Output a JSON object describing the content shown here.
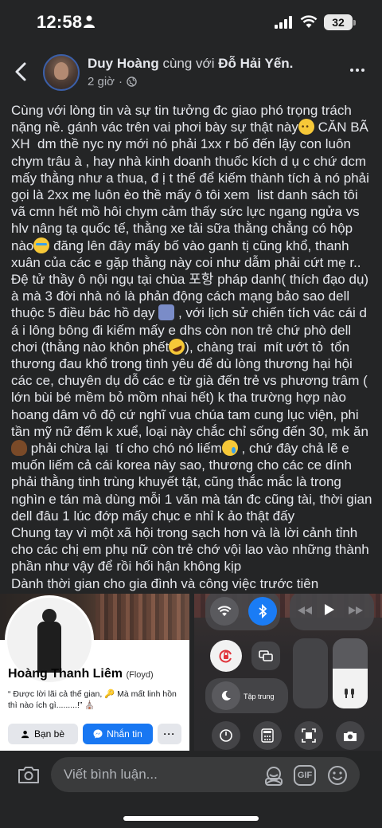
{
  "status_bar": {
    "time": "12:58",
    "battery": "32"
  },
  "header": {
    "author": "Duy Hoàng",
    "with_text": "cùng với",
    "tagged": "Đỗ Hải Yến.",
    "time_ago": "2 giờ",
    "separator": "·"
  },
  "post": {
    "paragraphs": [
      {
        "parts": [
          {
            "t": "Cùng với lòng tin và sự tin tưởng đc giao phó trọng trách nặng nề. gánh vác trên vai phơi bày sự thật này"
          },
          {
            "e": "frown"
          },
          {
            "t": " CĂN BÃ XH  dm thề nyc ny mới nó phải 1xx r bố đến lậy con luôn chym trâu à , hay nhà kinh doanh thuốc kích d ụ c chứ dcm mấy thằng như a thua, đ ị t thế để kiếm thành tích à nó phải gọi là 2xx mẹ luôn èo thề mấy ô tôi xem  list danh sách tôi vã cmn hết mồ hôi chym cảm thấy sức lực ngang ngửa vs hlv nâng tạ quốc tế, thằng xe tải sữa thằng chẳng có hộp nào"
          },
          {
            "e": "cry"
          },
          {
            "t": " đăng lên đây mấy bố vào ganh tị cũng khổ, thanh xuân của các e gặp thằng này coi như dẫm phải cứt mẹ r.."
          }
        ]
      },
      {
        "parts": [
          {
            "t": "Đệ tử thầy ô nội ngụ tại chùa 포항 pháp danh( thích đạo dụ) à mà 3 đời nhà nó là phản động cách mạng bảo sao dell thuộc 5 điều bác hồ dạy "
          },
          {
            "e": "shrug"
          },
          {
            "t": " , với lịch sử chiến tích vác cái d á i lông bông đi kiếm mấy e dhs còn non trẻ chứ phò dell chơi (thằng nào khôn phết"
          },
          {
            "e": "rofl"
          },
          {
            "t": "), chàng trai  mít ướt tỏ  tổn thương đau khổ trong tình yêu để dù lòng thương hại hội các ce, chuyên dụ dỗ các e từ già đến trẻ vs phương trâm ( lớn bùi bé mềm bỏ mồm nhai hết) k tha trường hợp nào hoang dâm vô độ cứ nghĩ vua chúa tam cung lục viện, phi tần mỹ nữ đếm k xuể, loại này chắc chỉ sống đến 30, mk ăn "
          },
          {
            "e": "poop"
          },
          {
            "t": " phải chừa lại  tí cho chó nó liếm"
          },
          {
            "e": "sad"
          },
          {
            "t": " , chứ đây chả lẽ e muốn liếm cả cái korea này sao, thương cho các ce dính phải thằng tinh trùng khuyết tật, cũng thắc mắc là trong nghìn e tán mà dùng mỗi 1 văn mà tán đc cũng tài, thời gian dell đâu 1 lúc đớp mấy chục e nhỉ k ảo thật đấy"
          }
        ]
      },
      {
        "parts": [
          {
            "t": "Chung tay vì một xã hội trong sạch hơn và là lời cảnh tỉnh cho các chị em phụ nữ còn trẻ chớ vội lao vào những thành phần như vậy để rồi hối hận không kịp"
          }
        ]
      },
      {
        "parts": [
          {
            "t": "Dành thời gian cho gia đình và công việc trước tiên"
          }
        ]
      }
    ]
  },
  "images": {
    "profile": {
      "name": "Hoàng Thanh Liêm",
      "nickname": "(Floyd)",
      "bio": "“ Được lời lãi cả thế gian,   🔑       Mà mất linh hồn thì nào ích gì.........!” ⛪",
      "friends_button": "Bạn bè",
      "message_button": "Nhắn tin",
      "more_button": "···"
    },
    "control_center": {
      "focus_label": "Tập trung"
    }
  },
  "comment_bar": {
    "placeholder": "Viết bình luận...",
    "gif_label": "GIF"
  },
  "colors": {
    "background": "#242526",
    "accent": "#1877f2",
    "input": "#3a3b3c"
  }
}
